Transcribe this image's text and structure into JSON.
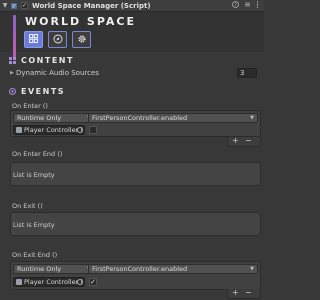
{
  "component": {
    "title": "World Space Manager (Script)",
    "enabled": true,
    "header_icons": [
      "help-icon",
      "preset-icon",
      "more-icon"
    ]
  },
  "banner": {
    "title": "WORLD SPACE",
    "tabs": [
      {
        "icon": "grid-icon",
        "active": true
      },
      {
        "icon": "compass-icon",
        "active": false
      },
      {
        "icon": "gear-icon",
        "active": false
      }
    ]
  },
  "content_section": {
    "title": "CONTENT",
    "dynamic_audio_label": "Dynamic Audio Sources",
    "dynamic_audio_value": "3"
  },
  "events_section": {
    "title": "EVENTS",
    "on_enter": {
      "label": "On Enter ()",
      "runtime": "Runtime Only",
      "function": "FirstPersonController.enabled",
      "object": "Player Controller (",
      "checked": false
    },
    "on_enter_end": {
      "label": "On Enter End ()",
      "empty": "List is Empty"
    },
    "on_exit": {
      "label": "On Exit ()",
      "empty": "List is Empty"
    },
    "on_exit_end": {
      "label": "On Exit End ()",
      "runtime": "Runtime Only",
      "function": "FirstPersonController.enabled",
      "object": "Player Controller (",
      "checked": true
    },
    "plus": "+",
    "minus": "−"
  },
  "colors": {
    "accent": "#6a7bd8",
    "banner_gradient": [
      "#8a64c8",
      "#c45ab0"
    ],
    "panel": "#383838"
  }
}
